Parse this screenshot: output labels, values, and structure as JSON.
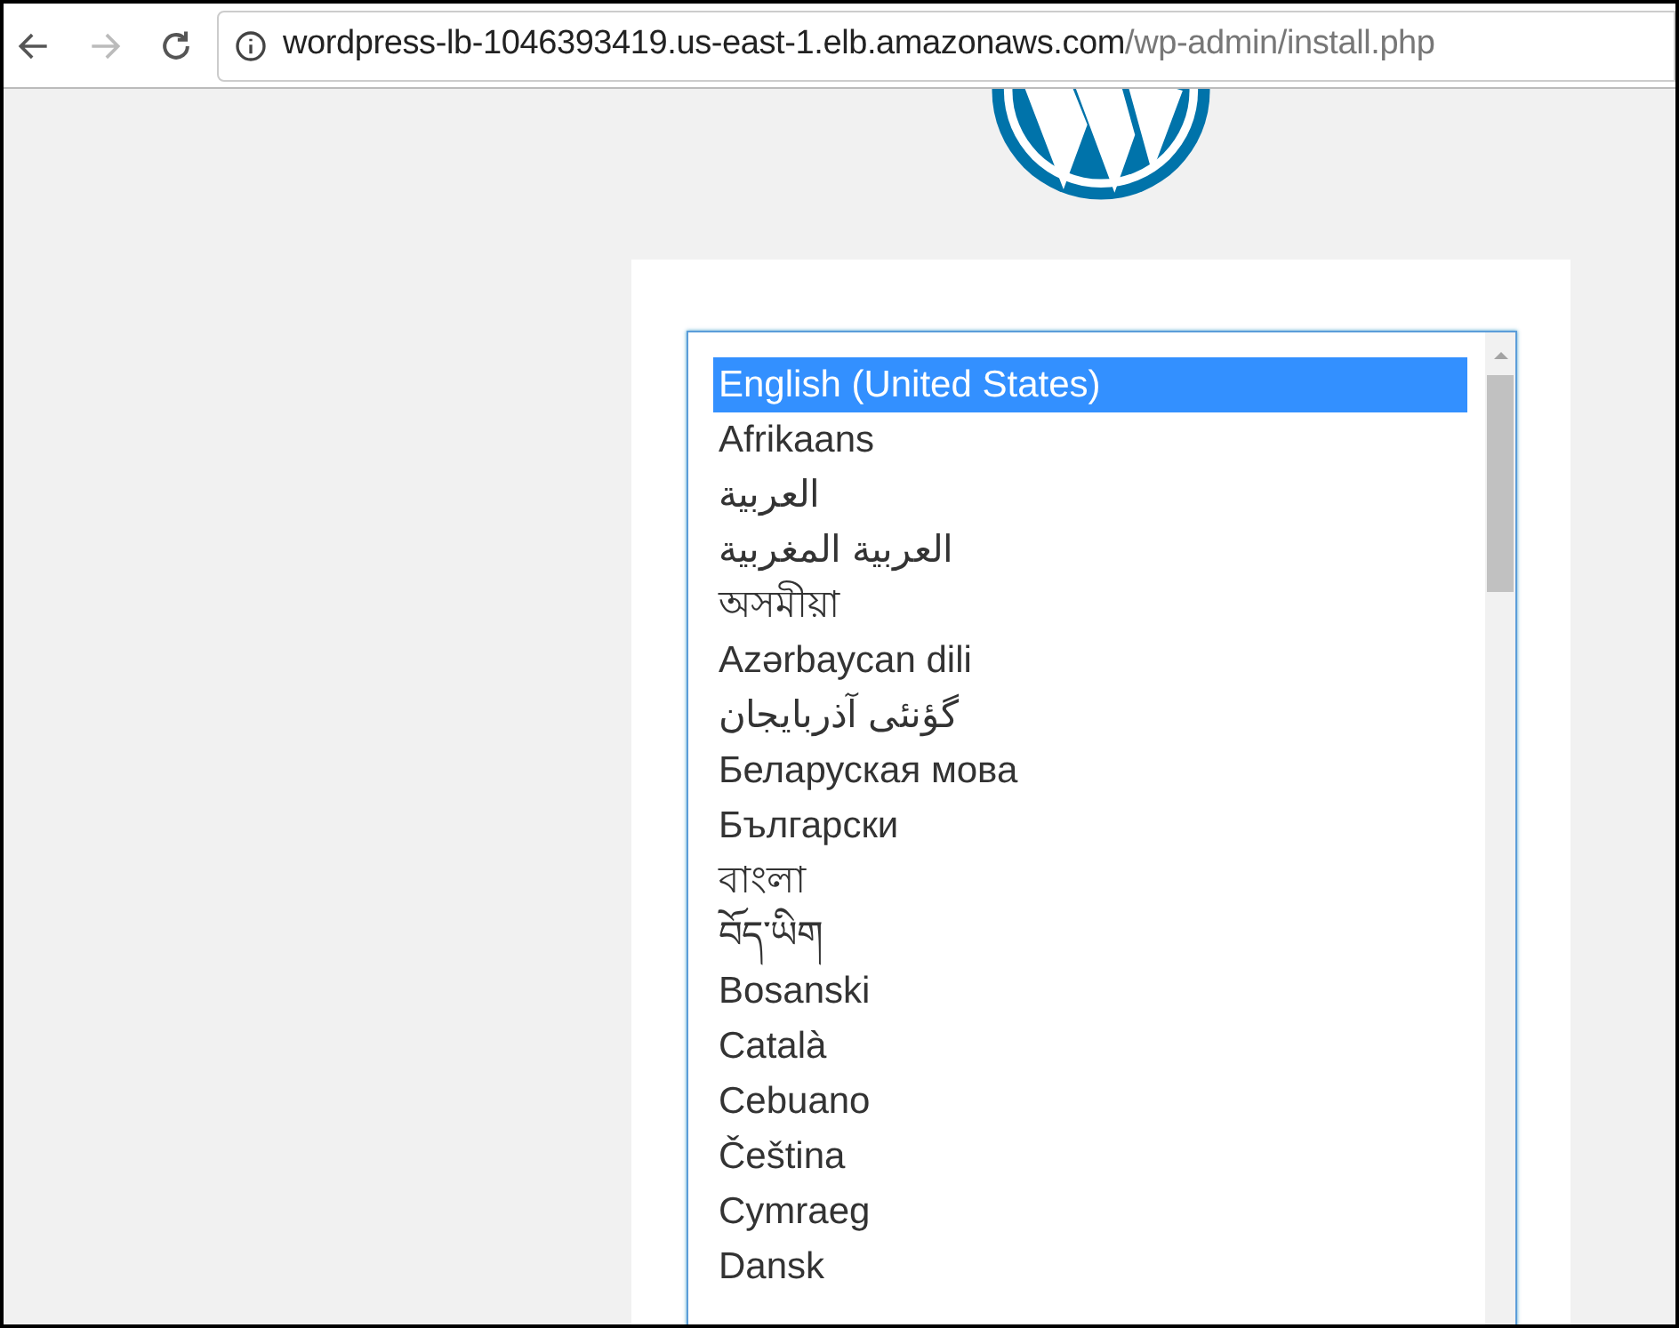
{
  "browser": {
    "address": {
      "host": "wordpress-lb-1046393419.us-east-1.elb.amazonaws.com",
      "path": "/wp-admin/install.php"
    }
  },
  "language_list": [
    {
      "label": "English (United States)",
      "selected": true
    },
    {
      "label": "Afrikaans",
      "selected": false
    },
    {
      "label": "العربية",
      "selected": false
    },
    {
      "label": "العربية المغربية",
      "selected": false
    },
    {
      "label": "অসমীয়া",
      "selected": false
    },
    {
      "label": "Azərbaycan dili",
      "selected": false
    },
    {
      "label": "گؤنئی آذربایجان",
      "selected": false
    },
    {
      "label": "Беларуская мова",
      "selected": false
    },
    {
      "label": "Български",
      "selected": false
    },
    {
      "label": "বাংলা",
      "selected": false
    },
    {
      "label": "བོད་ཡིག",
      "selected": false
    },
    {
      "label": "Bosanski",
      "selected": false
    },
    {
      "label": "Català",
      "selected": false
    },
    {
      "label": "Cebuano",
      "selected": false
    },
    {
      "label": "Čeština",
      "selected": false
    },
    {
      "label": "Cymraeg",
      "selected": false
    },
    {
      "label": "Dansk",
      "selected": false
    }
  ]
}
